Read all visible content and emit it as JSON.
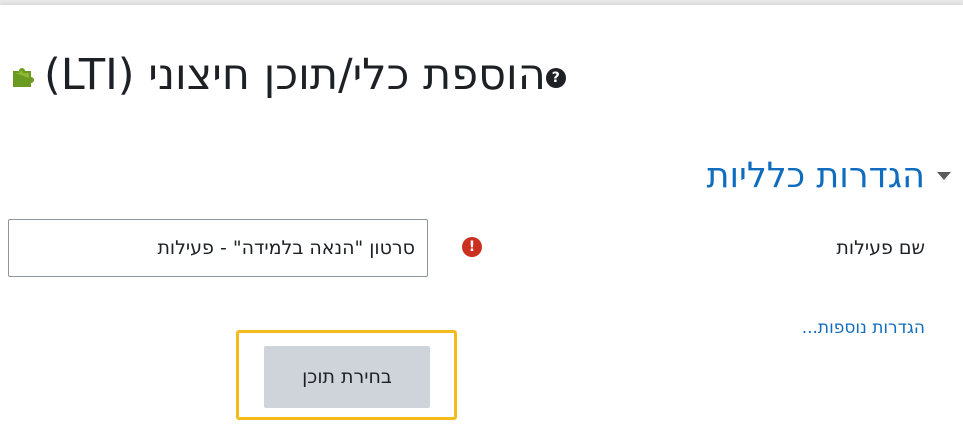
{
  "page": {
    "title": "הוספת כלי/תוכן חיצוני (LTI)",
    "help_icon": "question-icon",
    "title_icon": "puzzle-icon"
  },
  "section": {
    "title": "הגדרות כלליות",
    "expanded": true
  },
  "form": {
    "activity_name_label": "שם פעילות",
    "activity_name_value": "סרטון \"הנאה בלמידה\" - פעילות",
    "required_icon": "exclamation-icon",
    "more_settings_link": "הגדרות נוספות...",
    "select_content_button": "בחירת תוכן"
  },
  "colors": {
    "link": "#0f6cbf",
    "required": "#ca3120",
    "highlight": "#f3bb1b",
    "button_bg": "#ced4da",
    "puzzle": "#6a9a1f"
  }
}
